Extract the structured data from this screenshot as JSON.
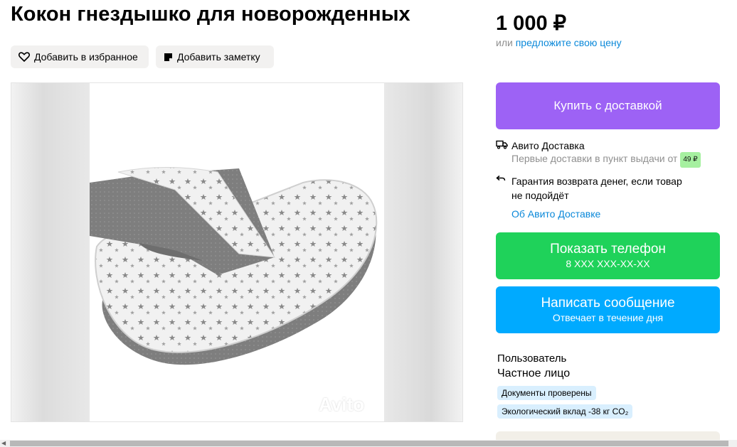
{
  "listing": {
    "title": "Кокон гнездышко для новорожденных"
  },
  "actions": {
    "favorite_label": "Добавить в избранное",
    "note_label": "Добавить заметку"
  },
  "gallery": {
    "watermark": "Avito"
  },
  "price": {
    "value": "1 000 ₽",
    "or_text": "или",
    "offer_link": "предложите свою цену"
  },
  "buy": {
    "label": "Купить с доставкой"
  },
  "delivery": {
    "title": "Авито Доставка",
    "subtitle": "Первые доставки в пункт выдачи от",
    "price_badge": "49 ₽",
    "guarantee_line1": "Гарантия возврата денег, если товар",
    "guarantee_line2": "не подойдёт",
    "about_link": "Об Авито Доставке"
  },
  "contact": {
    "phone_label": "Показать телефон",
    "phone_masked": "8 XXX XXX-XX-XX",
    "message_label": "Написать сообщение",
    "message_sub": "Отвечает в течение дня"
  },
  "seller": {
    "name": "Пользователь",
    "type": "Частное лицо",
    "badges": [
      "Документы проверены",
      "Экологический вклад -38 кг CO₂"
    ]
  },
  "colors": {
    "buy": "#9d62f5",
    "phone": "#1fd25a",
    "message": "#00aaff",
    "link": "#0a88d9"
  }
}
